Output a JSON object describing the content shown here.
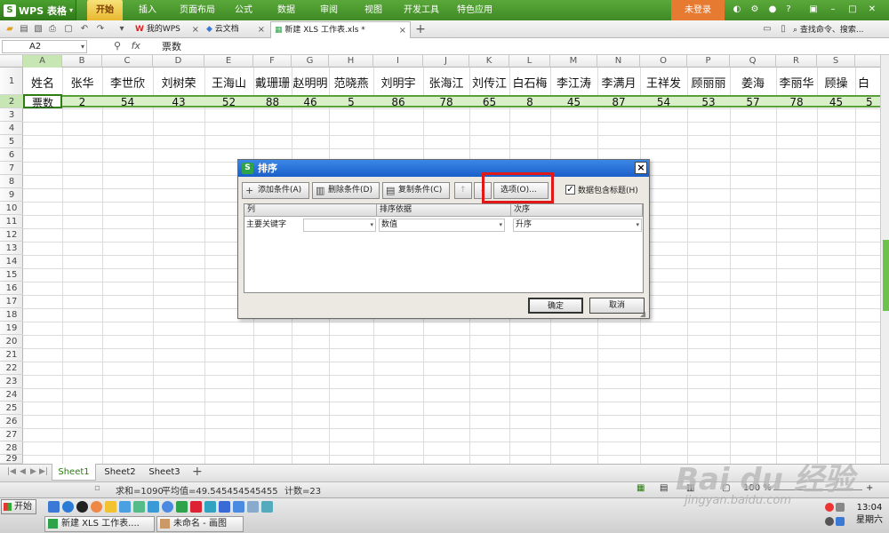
{
  "app": {
    "name": "WPS 表格",
    "login": "未登录"
  },
  "menu": [
    "开始",
    "插入",
    "页面布局",
    "公式",
    "数据",
    "审阅",
    "视图",
    "开发工具",
    "特色应用"
  ],
  "tabs": {
    "my_wps": "我的WPS",
    "cloud": "云文档",
    "active_doc": "新建 XLS 工作表.xls *",
    "search": "查找命令、搜索..."
  },
  "formula_bar": {
    "name_box": "A2",
    "fx": "fx",
    "value": "票数"
  },
  "columns": [
    "A",
    "B",
    "C",
    "D",
    "E",
    "F",
    "G",
    "H",
    "I",
    "J",
    "K",
    "L",
    "M",
    "N",
    "O",
    "P",
    "Q",
    "R",
    "S"
  ],
  "rows": [
    "1",
    "2",
    "3",
    "4",
    "5",
    "6",
    "7",
    "8",
    "9",
    "10",
    "11",
    "12",
    "13",
    "14",
    "15",
    "16",
    "17",
    "18",
    "19",
    "20",
    "21",
    "22",
    "23",
    "24",
    "25",
    "26",
    "27",
    "28",
    "29"
  ],
  "grid": {
    "row1": [
      "姓名",
      "张华",
      "李世欣",
      "刘树荣",
      "王海山",
      "戴珊珊",
      "赵明明",
      "范晓燕",
      "刘明宇",
      "张海江",
      "刘传江",
      "白石梅",
      "李江涛",
      "李满月",
      "王祥发",
      "顾丽丽",
      "姜海",
      "李丽华",
      "顾操",
      "白"
    ],
    "row2": [
      "票数",
      "2",
      "54",
      "43",
      "52",
      "88",
      "46",
      "5",
      "86",
      "78",
      "65",
      "8",
      "45",
      "87",
      "54",
      "53",
      "57",
      "78",
      "45",
      "5"
    ]
  },
  "sheets": [
    "Sheet1",
    "Sheet2",
    "Sheet3"
  ],
  "status": {
    "sum": "求和=1090",
    "avg": "平均值=49.545454545455",
    "count": "计数=23",
    "zoom": "100 %"
  },
  "taskbar": {
    "start": "开始",
    "task1": "新建 XLS 工作表....",
    "task2": "未命名 - 画图",
    "time": "13:04",
    "day": "星期六"
  },
  "dialog": {
    "title": "排序",
    "close": "×",
    "add": "添加条件(A)",
    "delete": "删除条件(D)",
    "copy": "复制条件(C)",
    "up": "↑",
    "down": "↓",
    "options": "选项(O)...",
    "has_header": "数据包含标题(H)",
    "headers": [
      "列",
      "排序依据",
      "次序"
    ],
    "primary_key": "主要关键字",
    "key_value": "",
    "basis": "数值",
    "order": "升序",
    "ok": "确定",
    "cancel": "取消"
  },
  "watermark": {
    "main": "Bai du 经验",
    "sub": "jingyan.baidu.com"
  }
}
